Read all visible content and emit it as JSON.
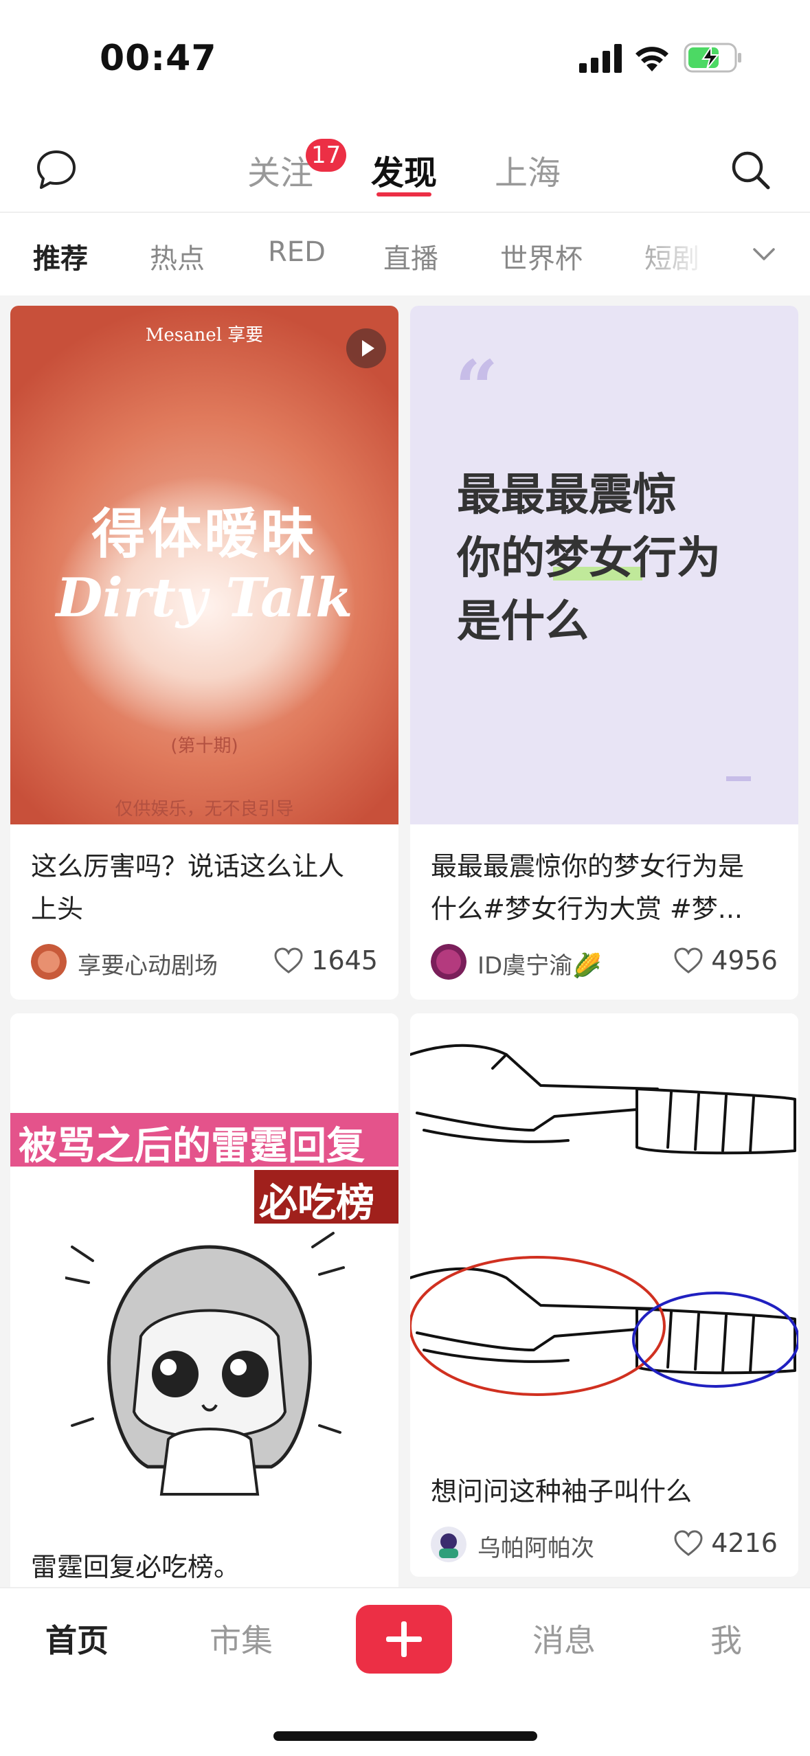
{
  "status_bar": {
    "time": "00:47"
  },
  "top_nav": {
    "tabs": [
      {
        "label": "关注",
        "badge": "17"
      },
      {
        "label": "发现"
      },
      {
        "label": "上海"
      }
    ],
    "active_tab": "发现"
  },
  "categories": {
    "items": [
      "推荐",
      "热点",
      "RED",
      "直播",
      "世界杯",
      "短剧"
    ],
    "active": "推荐"
  },
  "feed": {
    "cards": [
      {
        "cover": {
          "brand": "Mesanel 享要",
          "title_cn": "得体暧昧",
          "title_en": "Dirty Talk",
          "issue": "(第十期)",
          "disclaimer": "仅供娱乐，无不良引导"
        },
        "title_line1": "这么厉害吗？说话这么让人",
        "title_line2": "上头",
        "author": "享要心动剧场",
        "likes": "1645"
      },
      {
        "cover": {
          "line1": "最最最震惊",
          "line2": "你的梦女行为",
          "line3": "是什么"
        },
        "title_line1": "最最最震惊你的梦女行为是",
        "title_line2": "什么#梦女行为大赏 #梦...",
        "author": "ID虞宁渝🌽",
        "likes": "4956"
      },
      {
        "cover": {
          "banner1": "被骂之后的雷霆回复",
          "banner2": "必吃榜"
        },
        "title_line1": "雷霆回复必吃榜。"
      },
      {
        "title_line1": "想问问这种袖子叫什么",
        "author": "乌帕阿帕次",
        "likes": "4216"
      }
    ]
  },
  "tab_bar": {
    "items": [
      "首页",
      "市集",
      "消息",
      "我"
    ],
    "active": "首页"
  },
  "colors": {
    "accent": "#ec2f45",
    "feed_bg": "#f4f4f4"
  }
}
